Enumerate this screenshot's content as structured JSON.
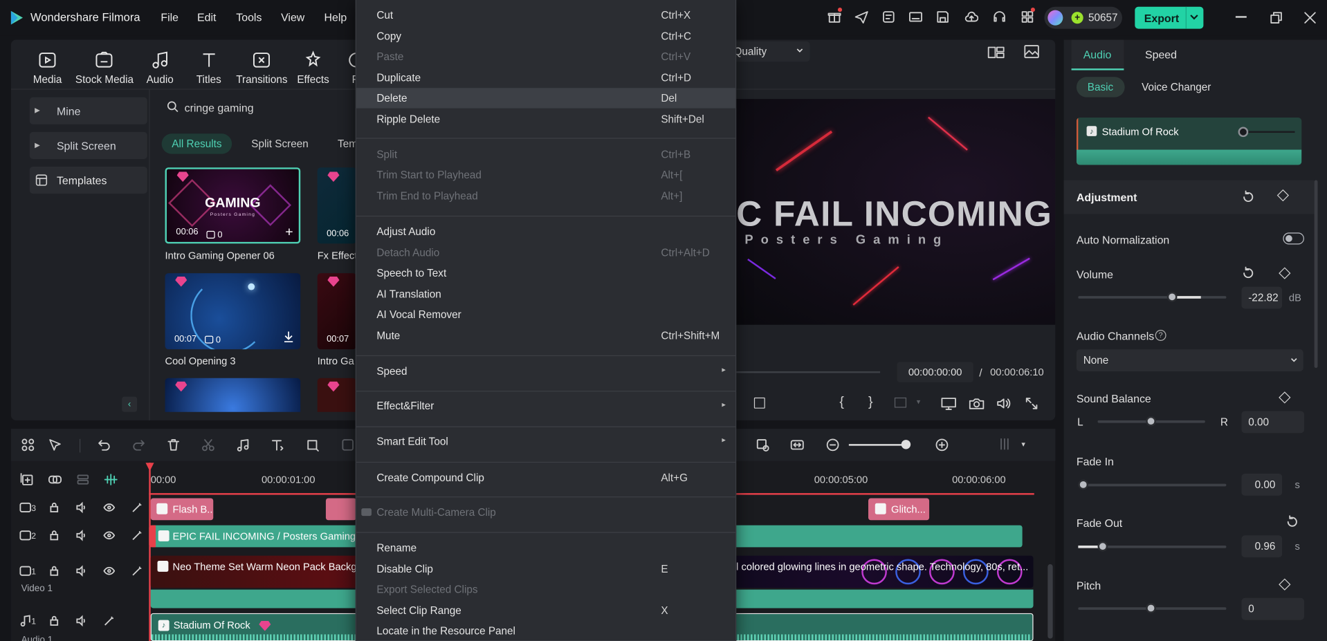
{
  "app": {
    "title": "Wondershare Filmora",
    "menus": [
      "File",
      "Edit",
      "Tools",
      "View",
      "Help"
    ],
    "credits": "50657",
    "export_label": "Export"
  },
  "toolbar": {
    "items": [
      "Media",
      "Stock Media",
      "Audio",
      "Titles",
      "Transitions",
      "Effects",
      "Fi"
    ]
  },
  "sidebar": {
    "items": [
      "Mine",
      "Split Screen",
      "Templates"
    ]
  },
  "search": {
    "value": "cringe gaming"
  },
  "filters": [
    "All Results",
    "Split Screen",
    "Tem"
  ],
  "thumbs": [
    {
      "label": "Intro Gaming Opener 06",
      "dur": "00:06",
      "count": "0",
      "text": "GAMING",
      "sub": "Posters Gaming"
    },
    {
      "label": "Fx Effect",
      "dur": "00:06"
    },
    {
      "label": "Cool Opening 3",
      "dur": "00:07",
      "count": "0"
    },
    {
      "label": "Intro Ga",
      "dur": "00:07"
    }
  ],
  "preview": {
    "quality": "Quality",
    "title": "C FAIL INCOMING",
    "subtitle": "Posters Gaming",
    "time_current": "00:00:00:00",
    "time_sep": "/",
    "time_total": "00:00:06:10"
  },
  "context_menu": {
    "items": [
      {
        "label": "Cut",
        "shortcut": "Ctrl+X",
        "disabled": false
      },
      {
        "label": "Copy",
        "shortcut": "Ctrl+C",
        "disabled": false
      },
      {
        "label": "Paste",
        "shortcut": "Ctrl+V",
        "disabled": true
      },
      {
        "label": "Duplicate",
        "shortcut": "Ctrl+D",
        "disabled": false
      },
      {
        "label": "Delete",
        "shortcut": "Del",
        "disabled": false
      },
      {
        "label": "Ripple Delete",
        "shortcut": "Shift+Del",
        "disabled": false
      },
      {
        "label": "Split",
        "shortcut": "Ctrl+B",
        "disabled": true
      },
      {
        "label": "Trim Start to Playhead",
        "shortcut": "Alt+[",
        "disabled": true
      },
      {
        "label": "Trim End to Playhead",
        "shortcut": "Alt+]",
        "disabled": true
      },
      {
        "label": "Adjust Audio",
        "shortcut": "",
        "disabled": false
      },
      {
        "label": "Detach Audio",
        "shortcut": "Ctrl+Alt+D",
        "disabled": true
      },
      {
        "label": "Speech to Text",
        "shortcut": "",
        "disabled": false
      },
      {
        "label": "AI Translation",
        "shortcut": "",
        "disabled": false
      },
      {
        "label": "AI Vocal Remover",
        "shortcut": "",
        "disabled": false
      },
      {
        "label": "Mute",
        "shortcut": "Ctrl+Shift+M",
        "disabled": false
      },
      {
        "label": "Speed",
        "shortcut": "",
        "disabled": false
      },
      {
        "label": "Effect&Filter",
        "shortcut": "",
        "disabled": false
      },
      {
        "label": "Smart Edit Tool",
        "shortcut": "",
        "disabled": false
      },
      {
        "label": "Create Compound Clip",
        "shortcut": "Alt+G",
        "disabled": false
      },
      {
        "label": "Create Multi-Camera Clip",
        "shortcut": "",
        "disabled": true
      },
      {
        "label": "Rename",
        "shortcut": "",
        "disabled": false
      },
      {
        "label": "Disable Clip",
        "shortcut": "E",
        "disabled": false
      },
      {
        "label": "Export Selected Clips",
        "shortcut": "",
        "disabled": true
      },
      {
        "label": "Select Clip Range",
        "shortcut": "X",
        "disabled": false
      },
      {
        "label": "Locate in the Resource Panel",
        "shortcut": "",
        "disabled": false
      }
    ]
  },
  "right_panel": {
    "tabs": [
      "Audio",
      "Speed"
    ],
    "subtabs": [
      "Basic",
      "Voice Changer"
    ],
    "clip_name": "Stadium Of Rock",
    "adjustment": "Adjustment",
    "auto_normalization": "Auto Normalization",
    "volume": {
      "label": "Volume",
      "value": "-22.82",
      "unit": "dB",
      "level": 0.63
    },
    "audio_channels": {
      "label": "Audio Channels",
      "value": "None"
    },
    "sound_balance": {
      "label": "Sound Balance",
      "left": "L",
      "right": "R",
      "value": "0.00",
      "level": 0.5
    },
    "fade_in": {
      "label": "Fade In",
      "value": "0.00",
      "unit": "s",
      "level": 0.0
    },
    "fade_out": {
      "label": "Fade Out",
      "value": "0.96",
      "unit": "s",
      "level": 0.17
    },
    "pitch": {
      "label": "Pitch",
      "value": "0",
      "level": 0.5
    }
  },
  "timeline": {
    "ruler": [
      "00:00",
      "00:00:01:00",
      "00:00:05:00",
      "00:00:06:00"
    ],
    "track_nums": [
      "3",
      "2",
      "1",
      "1"
    ],
    "video_label": "Video 1",
    "audio_label": "Audio 1",
    "clips": {
      "flash": "Flash B...",
      "glitch": "Glitch...",
      "title": "EPIC FAIL INCOMING / Posters Gaming",
      "video": "Neo Theme Set Warm Neon Pack Backg",
      "video_right": "l colored glowing lines in geometric shape. Technology, 80s, ret...",
      "audio": "Stadium Of Rock"
    }
  },
  "colors": {
    "accent": "#4fd1b4",
    "export": "#22d3a5",
    "track_teal": "#3ea78c",
    "pink": "#e8448e",
    "clip_pink": "#d46a86"
  }
}
